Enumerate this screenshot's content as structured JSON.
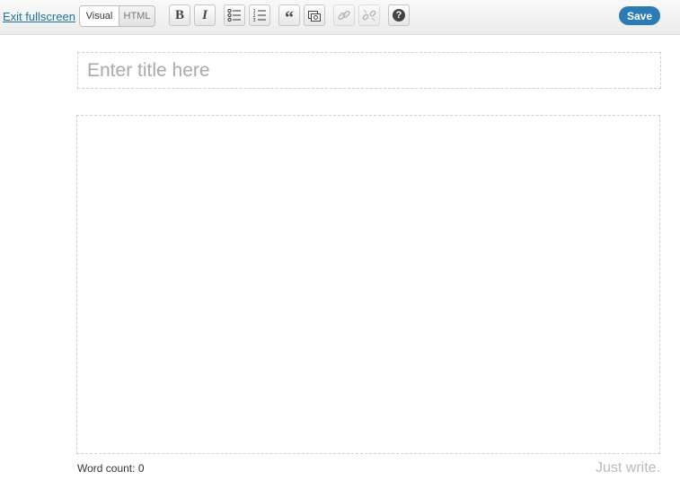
{
  "toolbar": {
    "exit_label": "Exit fullscreen",
    "modes": {
      "visual": "Visual",
      "html": "HTML"
    },
    "buttons": {
      "bold": "B",
      "italic": "I",
      "bullet_list": "bullet-list-icon",
      "numbered_list": "numbered-list-icon",
      "blockquote": "“",
      "insert_media": "media-icon",
      "link": "link-icon",
      "unlink": "unlink-icon",
      "help": "?"
    },
    "save_label": "Save"
  },
  "title": {
    "placeholder": "Enter title here",
    "value": ""
  },
  "editor": {
    "value": ""
  },
  "footer": {
    "word_count_label": "Word count:",
    "word_count": "0",
    "tagline": "Just write."
  },
  "colors": {
    "accent": "#2a7bb6",
    "link": "#21759b"
  }
}
